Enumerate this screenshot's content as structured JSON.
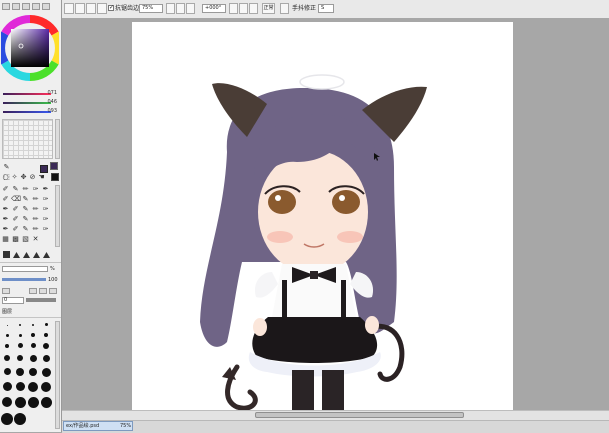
{
  "toolbar": {
    "checkbox_label": "抗锯齿边缘",
    "checkbox_checked": true,
    "zoom_value": "75%",
    "angle_value": "+000°",
    "reset_label": "正常",
    "stabilizer_label": "手抖修正",
    "stabilizer_value": "S"
  },
  "color_sliders": {
    "r_value": "071",
    "g_value": "046",
    "b_value": "093"
  },
  "colors": {
    "primary_swatch": "#3b2a56",
    "secondary_swatch": "#111111",
    "wheel_square_base": "#5a2aa8"
  },
  "layer_panel": {
    "opacity_value": "100",
    "blend_value": "0",
    "layer_name": "图层"
  },
  "statusbar": {
    "doc_name": "ex/作品绘.psd",
    "doc_zoom": "75%"
  }
}
